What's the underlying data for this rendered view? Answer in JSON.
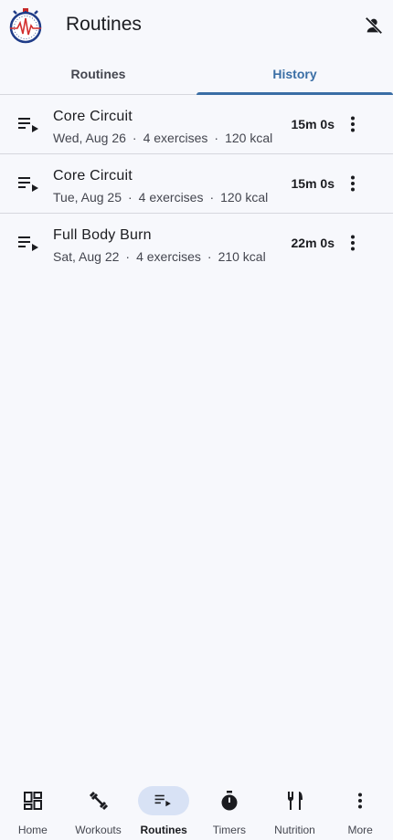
{
  "app": {
    "title": "Routines"
  },
  "icons": {
    "logo": "stopwatch-heartbeat-logo",
    "profile": "person-off-icon",
    "row": "playlist-play-icon",
    "menu": "more-vert-icon"
  },
  "tabs": [
    {
      "label": "Routines",
      "active": false
    },
    {
      "label": "History",
      "active": true
    }
  ],
  "history": [
    {
      "name": "Core Circuit",
      "date": "Wed, Aug 26",
      "exercises": "4 exercises",
      "kcal": "120 kcal",
      "duration": "15m 0s"
    },
    {
      "name": "Core Circuit",
      "date": "Tue, Aug 25",
      "exercises": "4 exercises",
      "kcal": "120 kcal",
      "duration": "15m 0s"
    },
    {
      "name": "Full Body Burn",
      "date": "Sat, Aug 22",
      "exercises": "4 exercises",
      "kcal": "210 kcal",
      "duration": "22m 0s"
    }
  ],
  "separator": "·",
  "nav": [
    {
      "label": "Home",
      "icon": "dashboard-icon",
      "active": false
    },
    {
      "label": "Workouts",
      "icon": "fitness-icon",
      "active": false
    },
    {
      "label": "Routines",
      "icon": "playlist-play-icon",
      "active": true
    },
    {
      "label": "Timers",
      "icon": "timer-icon",
      "active": false
    },
    {
      "label": "Nutrition",
      "icon": "restaurant-icon",
      "active": false
    },
    {
      "label": "More",
      "icon": "more-vert-icon",
      "active": false
    }
  ],
  "colors": {
    "accent": "#3a6ea5",
    "nav_active_bg": "#d8e2f5",
    "background": "#f7f8fc"
  }
}
